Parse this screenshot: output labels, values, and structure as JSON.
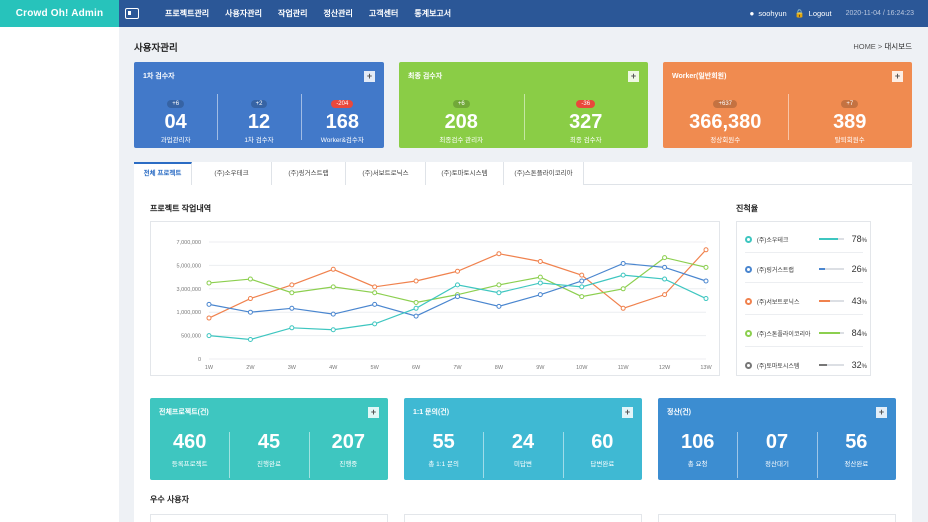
{
  "brand": "Crowd Oh! Admin",
  "nav": [
    "프로젝트관리",
    "사용자관리",
    "작업관리",
    "정산관리",
    "고객센터",
    "통계보고서"
  ],
  "user": {
    "name": "soohyun",
    "logout": "Logout",
    "datetime": "2020-11-04 / 16:24:23"
  },
  "page": {
    "title": "사용자관리",
    "breadcrumb_home": "HOME",
    "breadcrumb_sep": ">",
    "breadcrumb_current": "대시보드"
  },
  "cards_top": [
    {
      "title": "1차 검수자",
      "plus": "+",
      "cols": [
        {
          "badge": "+6",
          "badge_red": false,
          "num": "04",
          "label": "과업관리자"
        },
        {
          "badge": "+2",
          "badge_red": false,
          "num": "12",
          "label": "1차 검수자"
        },
        {
          "badge": "-204",
          "badge_red": true,
          "num": "168",
          "label": "Worker&검수자"
        }
      ]
    },
    {
      "title": "최종 검수자",
      "plus": "+",
      "cols": [
        {
          "badge": "+6",
          "badge_red": false,
          "num": "208",
          "label": "최종검수 관리자"
        },
        {
          "badge": "-36",
          "badge_red": true,
          "num": "327",
          "label": "최종 검수자"
        }
      ]
    },
    {
      "title": "Worker(일반회원)",
      "plus": "+",
      "cols": [
        {
          "badge": "+637",
          "badge_red": false,
          "num": "366,380",
          "label": "정상회원수"
        },
        {
          "badge": "+7",
          "badge_red": false,
          "num": "389",
          "label": "탈퇴회원수"
        }
      ]
    }
  ],
  "tabs": [
    "전체 프로젝트",
    "(주)소우테크",
    "(주)링거스트랩",
    "(주)서보트로닉스",
    "(주)토마토시스템",
    "(주)스톤플라이코리아"
  ],
  "chart_title": "프로젝트 작업내역",
  "chart_data": {
    "type": "line",
    "x": [
      "1W",
      "2W",
      "3W",
      "4W",
      "5W",
      "6W",
      "7W",
      "8W",
      "9W",
      "10W",
      "11W",
      "12W",
      "13W"
    ],
    "yticks": [
      "7,000,000",
      "5,000,000",
      "3,000,000",
      "1,000,000",
      "500,000",
      "0"
    ],
    "series": [
      {
        "color": "#f0824e",
        "values": [
          2.1,
          3.1,
          3.8,
          4.6,
          3.7,
          4.0,
          4.5,
          5.4,
          5.0,
          4.3,
          2.6,
          3.3,
          5.6
        ]
      },
      {
        "color": "#8ccf4f",
        "values": [
          3.9,
          4.1,
          3.4,
          3.7,
          3.4,
          2.9,
          3.3,
          3.8,
          4.2,
          3.2,
          3.6,
          5.2,
          4.7
        ]
      },
      {
        "color": "#4a86cf",
        "values": [
          2.8,
          2.4,
          2.6,
          2.3,
          2.8,
          2.2,
          3.2,
          2.7,
          3.3,
          4.0,
          4.9,
          4.7,
          4.0
        ]
      },
      {
        "color": "#3ec6c0",
        "values": [
          1.2,
          1.0,
          1.6,
          1.5,
          1.8,
          2.6,
          3.8,
          3.4,
          3.9,
          3.7,
          4.3,
          4.1,
          3.1
        ]
      }
    ]
  },
  "progress_title": "진척율",
  "progress": [
    {
      "name": "(주)소우테크",
      "pct": "78",
      "unit": "%",
      "color": "#3ec6c0",
      "value": 0.78
    },
    {
      "name": "(주)링거스트랩",
      "pct": "26",
      "unit": "%",
      "color": "#4a86cf",
      "value": 0.26
    },
    {
      "name": "(주)서보트로닉스",
      "pct": "43",
      "unit": "%",
      "color": "#f0824e",
      "value": 0.43
    },
    {
      "name": "(주)스톤플라이코리아",
      "pct": "84",
      "unit": "%",
      "color": "#8ccf4f",
      "value": 0.84
    },
    {
      "name": "(주)토마토시스템",
      "pct": "32",
      "unit": "%",
      "color": "#777777",
      "value": 0.32
    }
  ],
  "cards_bottom": [
    {
      "title": "전체프로젝트(건)",
      "plus": "+",
      "cols": [
        {
          "num": "460",
          "label": "등록프로젝트"
        },
        {
          "num": "45",
          "label": "진행완료"
        },
        {
          "num": "207",
          "label": "진행중"
        }
      ]
    },
    {
      "title": "1:1 문의(건)",
      "plus": "+",
      "cols": [
        {
          "num": "55",
          "label": "총 1:1 문의"
        },
        {
          "num": "24",
          "label": "미답변"
        },
        {
          "num": "60",
          "label": "답변완료"
        }
      ]
    },
    {
      "title": "정산(건)",
      "plus": "+",
      "cols": [
        {
          "num": "106",
          "label": "총 요청"
        },
        {
          "num": "07",
          "label": "정산대기"
        },
        {
          "num": "56",
          "label": "정산완료"
        }
      ]
    }
  ],
  "section2_title": "우수 사용자"
}
